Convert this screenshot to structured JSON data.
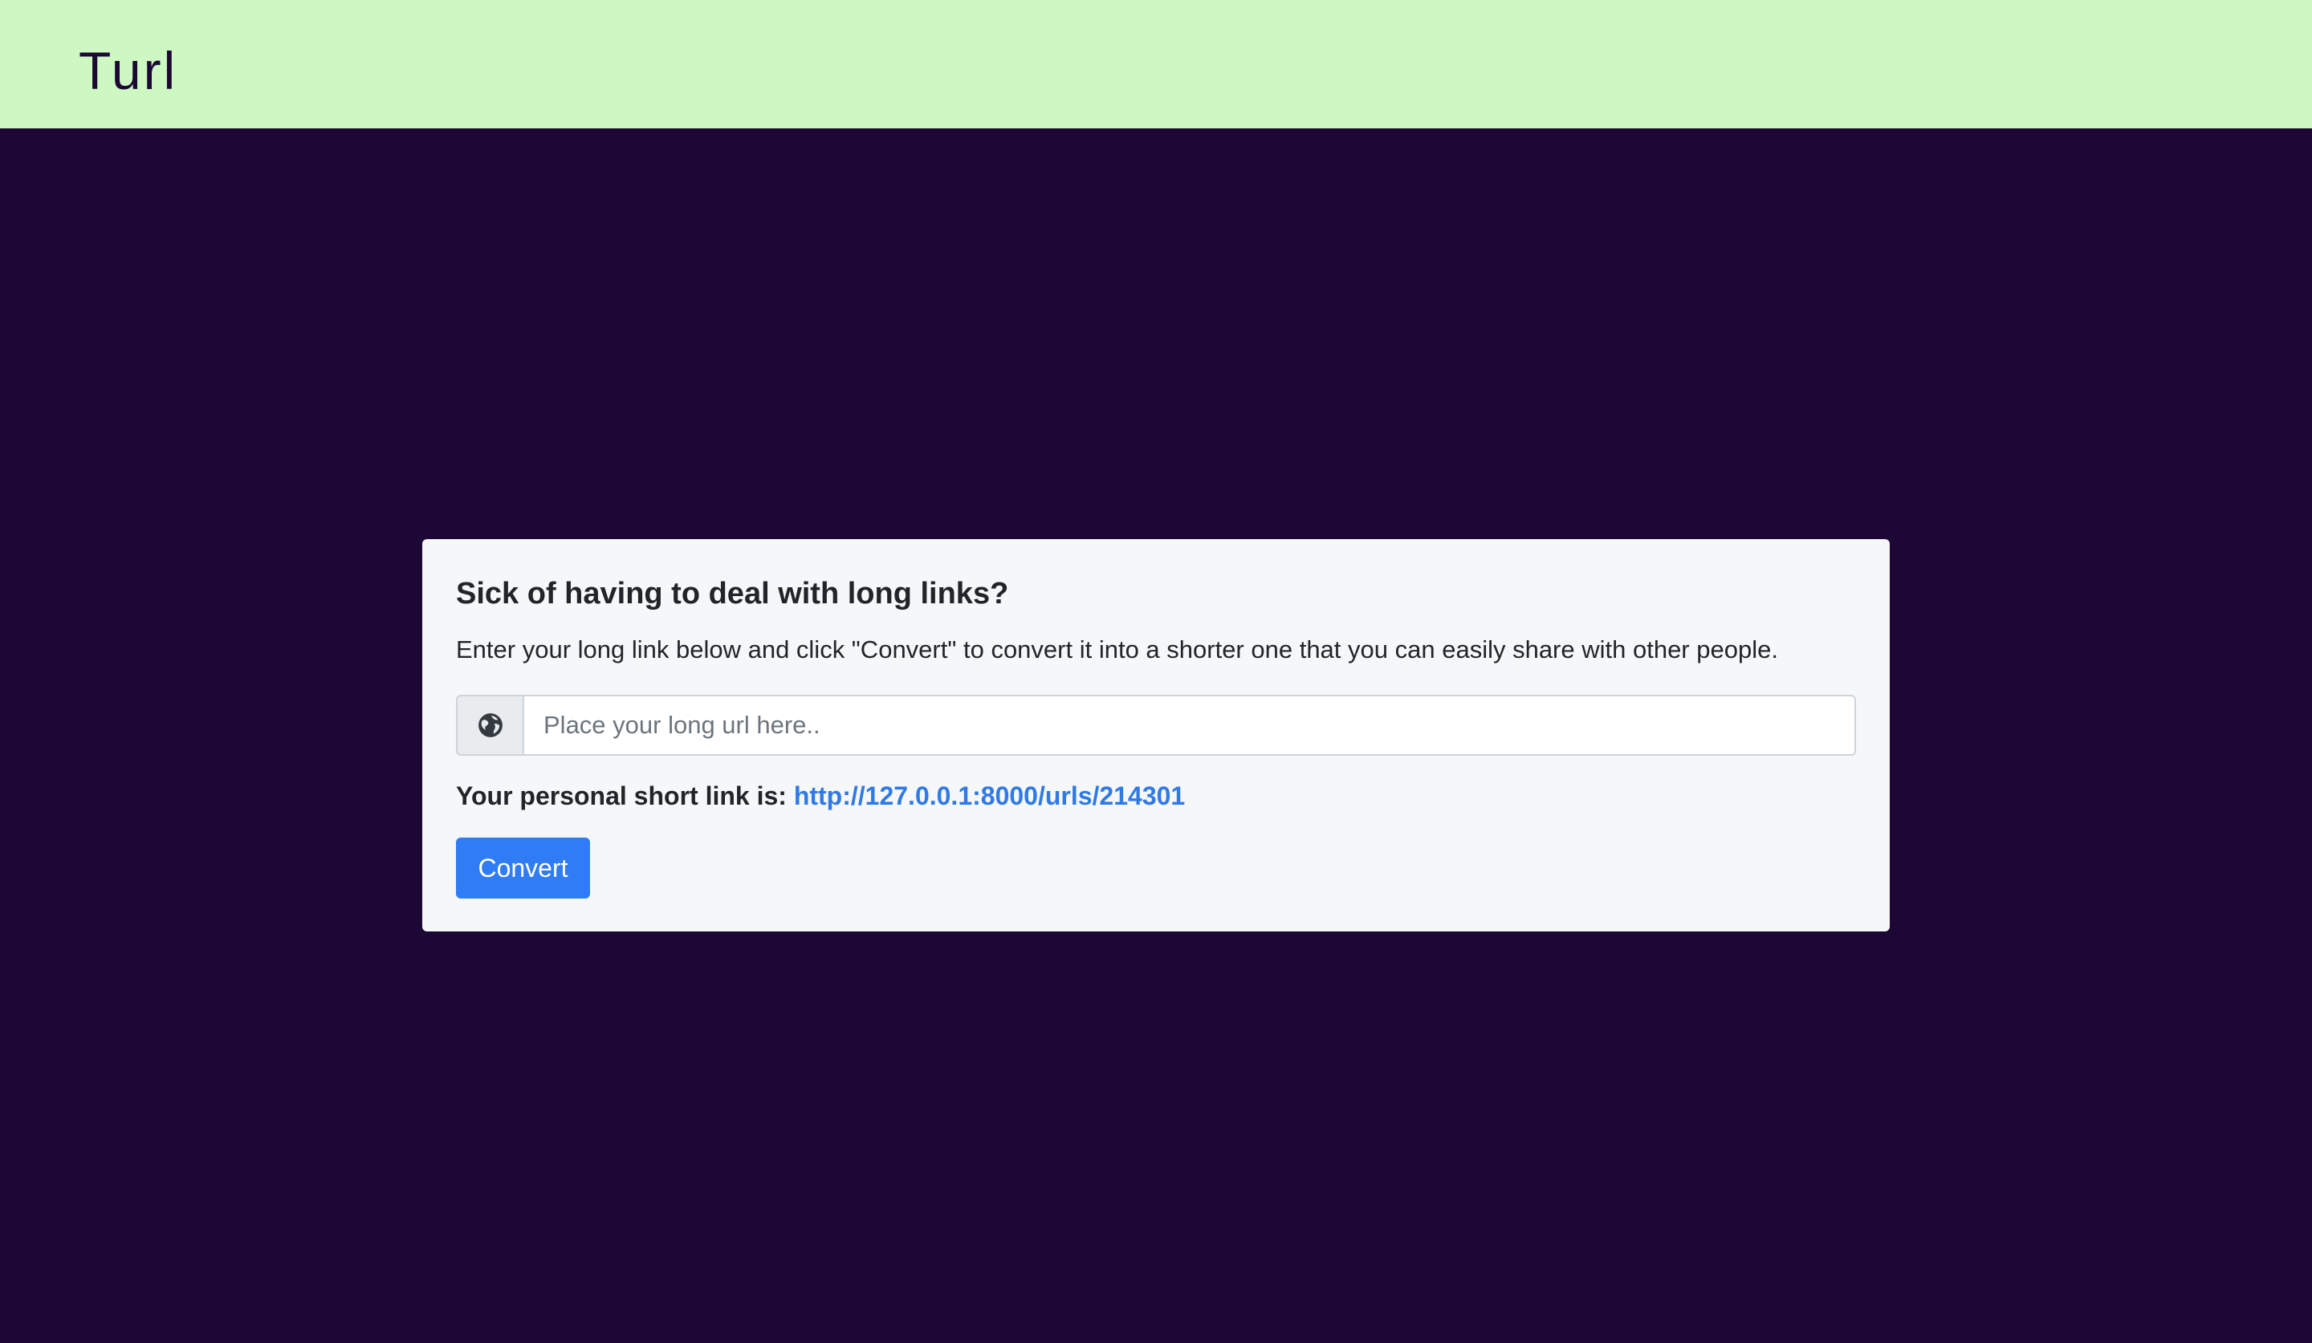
{
  "navbar": {
    "brand": "Turl",
    "bg_color": "#cdf8c1"
  },
  "page": {
    "bg_color": "#1d0835"
  },
  "card": {
    "title": "Sick of having to deal with long links?",
    "description": "Enter your long link below and click \"Convert\" to convert it into a shorter one that you can easily share with other people.",
    "input": {
      "icon": "globe-icon",
      "placeholder": "Place your long url here..",
      "value": ""
    },
    "result_label": "Your personal short link is:",
    "result_link": "http://127.0.0.1:8000/urls/214301",
    "link_color": "#2f7ae5",
    "convert_label": "Convert",
    "button_color": "#2f7cf4"
  }
}
